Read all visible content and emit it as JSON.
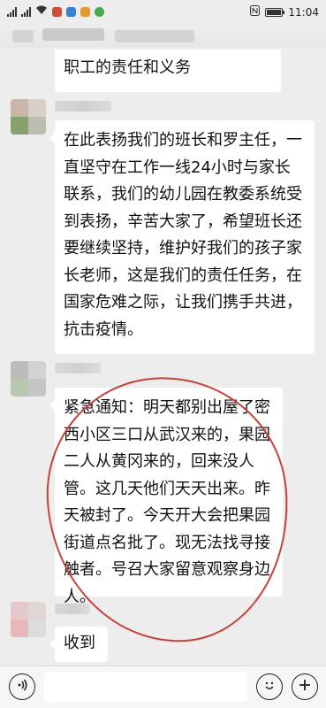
{
  "status_bar": {
    "carrier_icons": [
      "signal-icon",
      "signal-icon",
      "wifi-icon"
    ],
    "notification_icons": [
      "app-icon-a",
      "app-icon-b",
      "app-icon-c",
      "app-icon-d"
    ],
    "right_icons": [
      "nfc-icon",
      "battery-icon"
    ],
    "time": "11:04",
    "battery_level": 0.85
  },
  "messages": [
    {
      "type": "partial",
      "text": "职工的责任和义务"
    },
    {
      "type": "text",
      "text": "在此表扬我们的班长和罗主任，一直坚守在工作一线24小时与家长联系，我们的幼儿园在教委系统受到表扬，辛苦大家了，希望班长还要继续坚持，维护好我们的孩子家长老师，这是我们的责任任务，在国家危难之际，让我们携手共进，抗击疫情。"
    },
    {
      "type": "text",
      "text": "紧急通知：明天都别出屋了密西小区三口从武汉来的，果园二人从黄冈来的，回来没人管。这几天他们天天出来。昨天被封了。今天开大会把果园街道点名批了。现无法找寻接触者。号召大家留意观察身边人。",
      "highlighted": true
    },
    {
      "type": "text",
      "text": "收到"
    }
  ],
  "colors": {
    "background": "#ededed",
    "bubble": "#ffffff",
    "highlight_circle": "#c4433b"
  },
  "input_bar": {
    "voice_icon": "voice-icon",
    "emoji_icon": "emoji-icon",
    "plus_icon": "plus-icon"
  }
}
